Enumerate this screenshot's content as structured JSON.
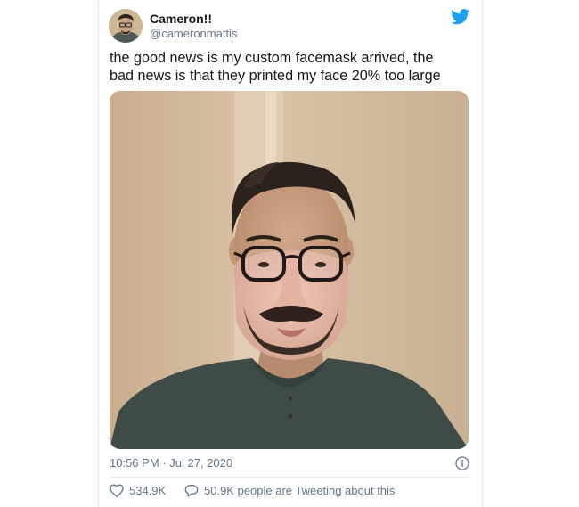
{
  "tweet": {
    "display_name": "Cameron!!",
    "handle": "@cameronmattis",
    "text_line1": "the good news is my custom facemask arrived, the",
    "text_line2": "bad news is that they printed my face 20% too large",
    "time": "10:56 PM",
    "separator": "·",
    "date": "Jul 27, 2020",
    "like_count": "534.9K",
    "retweet_text": "50.9K people are Tweeting about this"
  },
  "icons": {
    "brand": "twitter-bird-icon",
    "info": "info-icon",
    "like": "heart-icon",
    "reply": "speech-bubble-icon"
  },
  "colors": {
    "brand_blue": "#1da1f2",
    "text_primary": "#14171a",
    "text_secondary": "#657786",
    "divider": "#e6ecf0"
  }
}
